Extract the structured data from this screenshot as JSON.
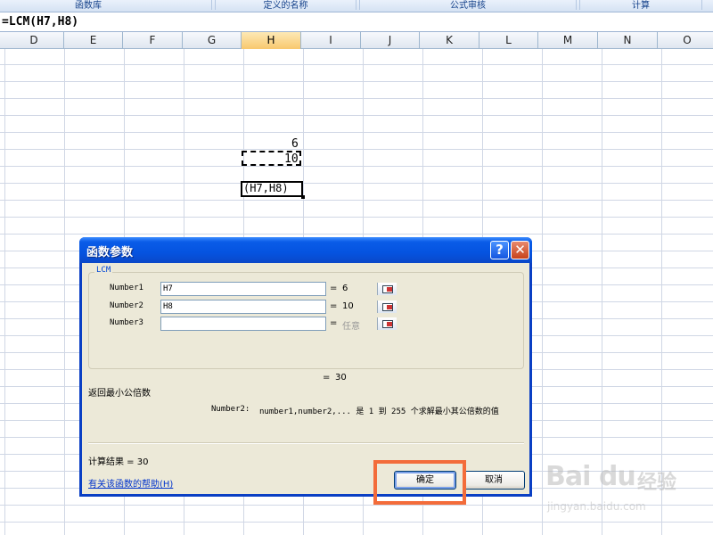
{
  "ribbon": {
    "tabs": [
      "函数库",
      "定义的名称",
      "公式审核",
      "计算"
    ]
  },
  "formula_bar": {
    "formula": "=LCM(H7,H8)"
  },
  "columns": [
    "D",
    "E",
    "F",
    "G",
    "H",
    "I",
    "J",
    "K",
    "L",
    "M",
    "N",
    "O"
  ],
  "selected_column": "H",
  "cells": {
    "h7": "6",
    "h8": "10",
    "edit_cell": "(H7,H8)"
  },
  "dialog": {
    "title": "函数参数",
    "help_glyph": "?",
    "close_glyph": "✕",
    "function_name": "LCM",
    "args": [
      {
        "label": "Number1",
        "value": "H7",
        "result": "6"
      },
      {
        "label": "Number2",
        "value": "H8",
        "result": "10"
      },
      {
        "label": "Number3",
        "value": "",
        "result": "任意"
      }
    ],
    "equals": "=",
    "total_result": "30",
    "description": "返回最小公倍数",
    "arg_desc_label": "Number2:",
    "arg_desc_text": "number1,number2,... 是 1 到 255 个求解最小其公倍数的值",
    "calc_result_label": "计算结果 = 30",
    "help_link": "有关该函数的帮助(H)",
    "ok_label": "确定",
    "cancel_label": "取消"
  },
  "colors": {
    "title_bar": "#0553e0",
    "highlight_box": "#f36c3a",
    "dialog_bg": "#ece9d8"
  },
  "watermark": {
    "brand": "Bai du",
    "jy": "经验",
    "url": "jingyan.baidu.com"
  }
}
